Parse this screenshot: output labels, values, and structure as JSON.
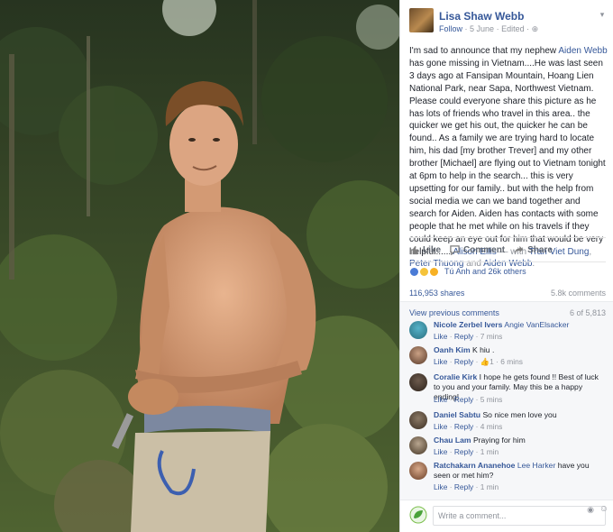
{
  "post": {
    "author": "Lisa Shaw Webb",
    "follow": "Follow",
    "date": "5 June",
    "edited": "Edited",
    "privacy_icon": "globe-icon",
    "text_parts": [
      {
        "t": "I'm sad to announce that my nephew ",
        "s": "plain"
      },
      {
        "t": "Aiden Webb",
        "s": "link"
      },
      {
        "t": " has gone missing in Vietnam....He was last seen 3 days ago at Fansipan Mountain, Hoang Lien National Park, near Sapa, Northwest Vietnam. Please could everyone share this picture as he has lots of friends who travel in this area.. the quicker we get his out, the quicker he can be found.. As a family we are trying hard to locate him, his dad [my brother Trever] and my other brother [Michael] are flying out to Vietnam tonight at 6pm to help in the search... this is very upsetting for our family.. but with the help from social media we can we band together and search for Aiden. Aiden has contacts with some people that he met while on his travels if they could keep an eye out for him that would be very helpful...... ",
        "s": "plain"
      },
      {
        "t": "Alison Ellis",
        "s": "link"
      },
      {
        "t": " — with ",
        "s": "muted"
      },
      {
        "t": "Tran Viet Dung",
        "s": "link"
      },
      {
        "t": ", ",
        "s": "muted"
      },
      {
        "t": "Peter Thuong",
        "s": "link"
      },
      {
        "t": " and ",
        "s": "muted"
      },
      {
        "t": "Aiden Webb",
        "s": "link"
      },
      {
        "t": ".",
        "s": "muted"
      }
    ]
  },
  "actions": {
    "like": "Like",
    "comment": "Comment",
    "share": "Share"
  },
  "reactions": {
    "text": "Tú Anh and 26k others",
    "types": [
      "like",
      "sad",
      "wow"
    ]
  },
  "stats": {
    "shares": "116,953 shares",
    "comments": "5.8k comments"
  },
  "comments_header": {
    "view_previous": "View previous comments",
    "count": "6 of 5,813"
  },
  "comments": [
    {
      "name": "Nicole Zerbel Ivers",
      "tag": "Angie VanElsacker",
      "text": "",
      "like": "Like",
      "reply": "Reply",
      "time": "7 mins",
      "likes": ""
    },
    {
      "name": "Oanh Kim",
      "tag": "",
      "text": "K hiu .",
      "like": "Like",
      "reply": "Reply",
      "time": "6 mins",
      "likes": "1"
    },
    {
      "name": "Coralie Kirk",
      "tag": "",
      "text": "I hope he gets found !! Best of luck to you and your family. May this be a happy ending!",
      "like": "Like",
      "reply": "Reply",
      "time": "5 mins",
      "likes": ""
    },
    {
      "name": "Daniel Sabtu",
      "tag": "",
      "text": "So nice men love you",
      "like": "Like",
      "reply": "Reply",
      "time": "4 mins",
      "likes": ""
    },
    {
      "name": "Chau Lam",
      "tag": "",
      "text": "Praying for him",
      "like": "Like",
      "reply": "Reply",
      "time": "1 min",
      "likes": ""
    },
    {
      "name": "Ratchakarn Ananehoe",
      "tag": "Lee Harker",
      "text": "have you seen or met him?",
      "like": "Like",
      "reply": "Reply",
      "time": "1 min",
      "likes": ""
    }
  ],
  "composer": {
    "placeholder": "Write a comment..."
  },
  "colors": {
    "link": "#365899",
    "muted": "#90949c",
    "text": "#1d2129"
  }
}
